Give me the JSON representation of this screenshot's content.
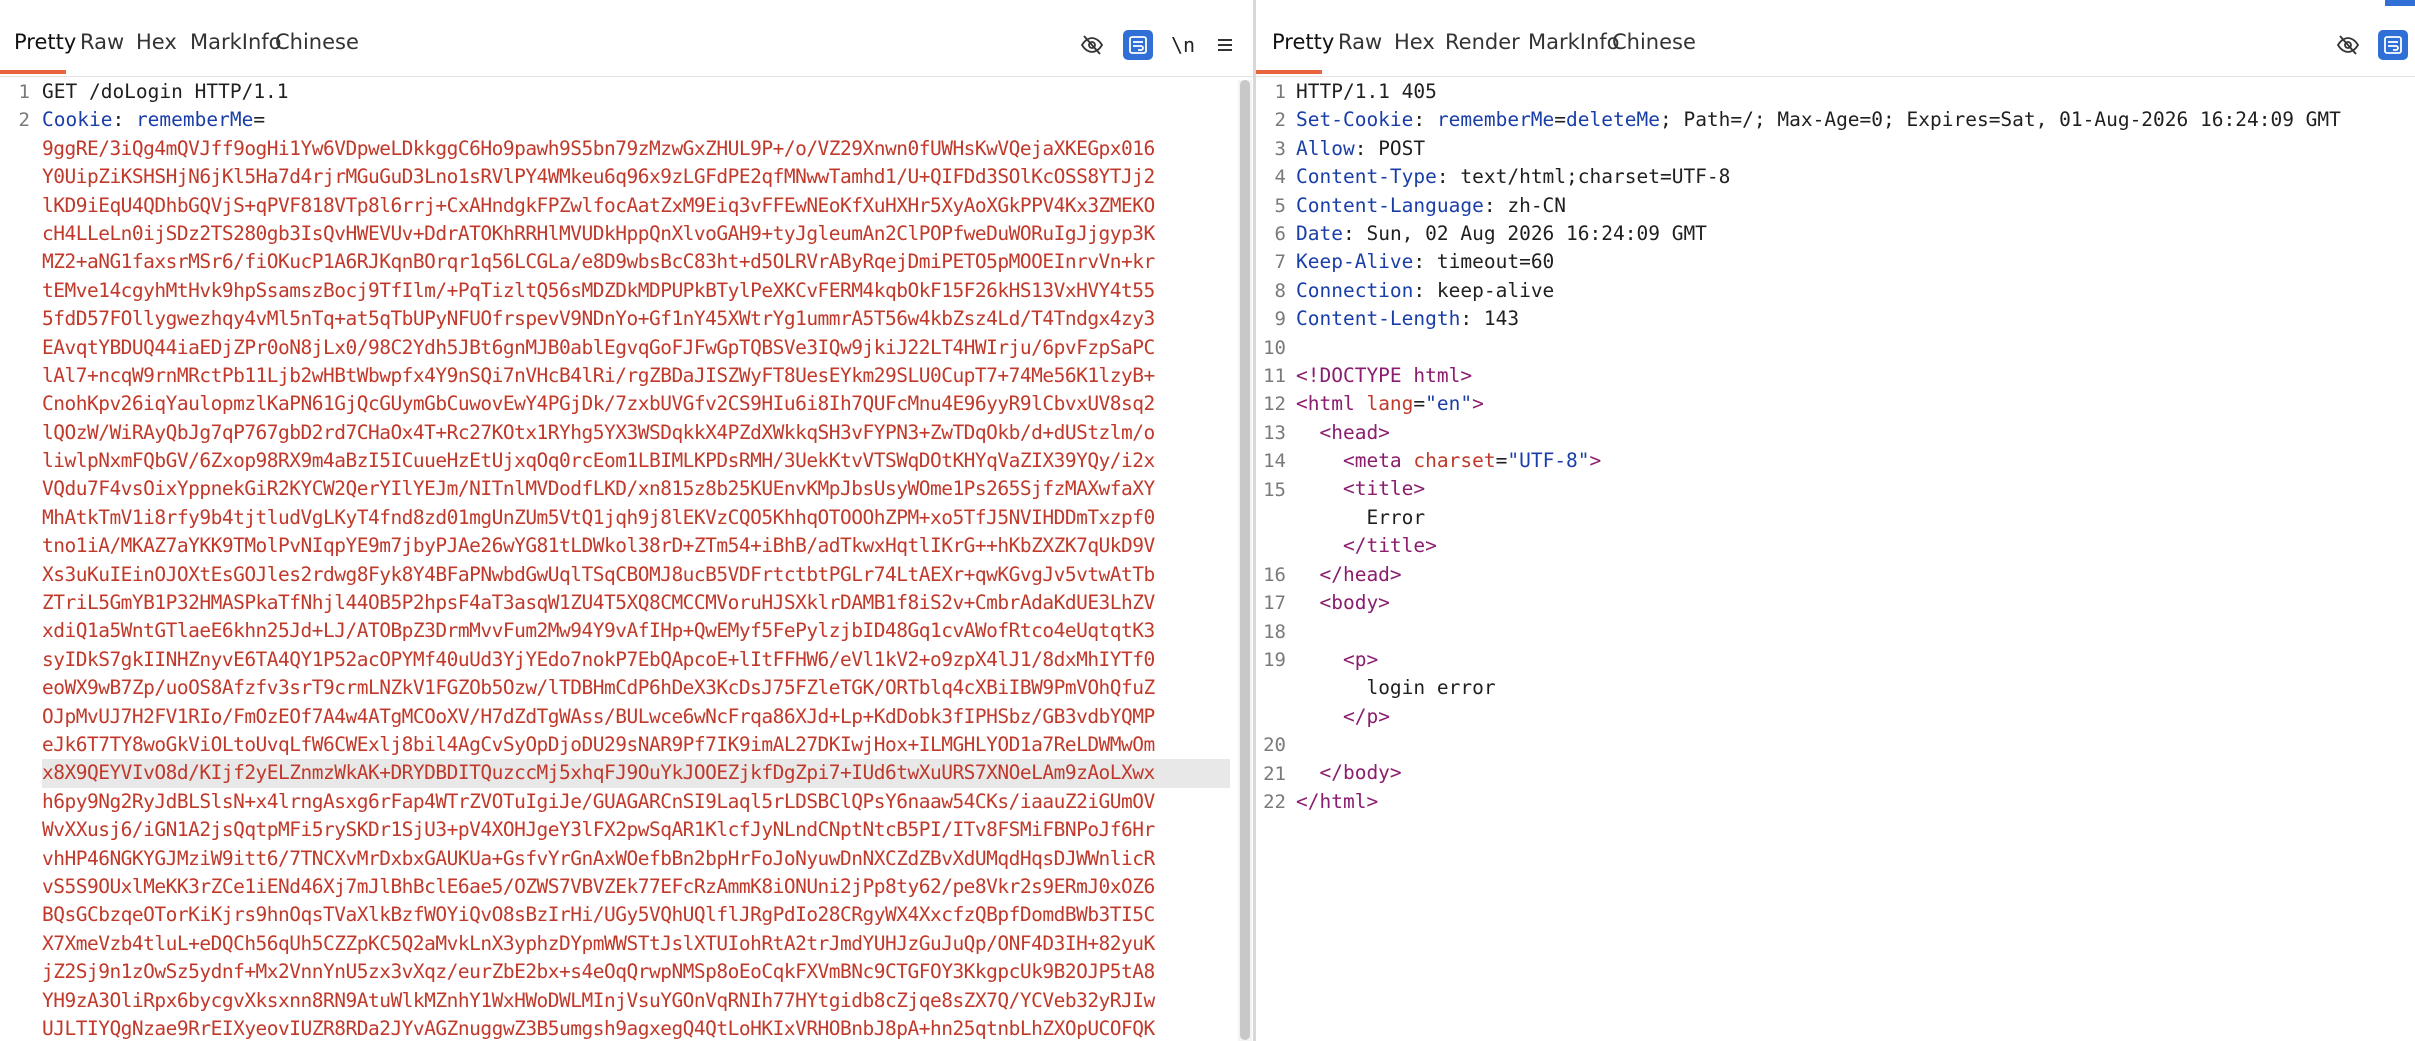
{
  "request": {
    "tabs": [
      "Pretty",
      "Raw",
      "Hex",
      "MarkInfo",
      "Chinese"
    ],
    "active_tab": "Pretty",
    "wrap_label": "\\n",
    "line1": "GET /doLogin HTTP/1.1",
    "cookie_key": "Cookie",
    "cookie_name": "rememberMe",
    "cookie_eq": "=",
    "cookie_lines": [
      "9ggRE/3iQg4mQVJff9ogHi1Yw6VDpweLDkkggC6Ho9pawh9S5bn79zMzwGxZHUL9P+/o/VZ29Xnwn0fUWHsKwVQejaXKEGpx016",
      "Y0UipZiKSHSHjN6jKl5Ha7d4rjrMGuGuD3Lno1sRVlPY4WMkeu6q96x9zLGFdPE2qfMNwwTamhd1/U+QIFDd3SOlKcOSS8YTJj2",
      "lKD9iEqU4QDhbGQVjS+qPVF818VTp8l6rrj+CxAHndgkFPZwlfocAatZxM9Eiq3vFFEwNEoKfXuHXHr5XyAoXGkPPV4Kx3ZMEKO",
      "cH4LLeLn0ijSDz2TS280gb3IsQvHWEVUv+DdrATOKhRRHlMVUDkHppQnXlvoGAH9+tyJgleumAn2ClPOPfweDuWORuIgJjgyp3K",
      "MZ2+aNG1faxsrMSr6/fiOKucP1A6RJKqnBOrqr1q56LCGLa/e8D9wbsBcC83ht+d5OLRVrAByRqejDmiPETO5pMOOEInrvVn+kr",
      "tEMve14cgyhMtHvk9hpSsamszBocj9TfIlm/+PqTizltQ56sMDZDkMDPUPkBTylPeXKCvFERM4kqbOkF15F26kHS13VxHVY4t55",
      "5fdD57FOllygwezhqy4vMl5nTq+at5qTbUPyNFUOfrspevV9NDnYo+Gf1nY45XWtrYg1ummrA5T56w4kbZsz4Ld/T4Tndgx4zy3",
      "EAvqtYBDUQ44iaEDjZPr0oN8jLx0/98C2Ydh5JBt6gnMJB0ablEgvqGoFJFwGpTQBSVe3IQw9jkiJ22LT4HWIrju/6pvFzpSaPC",
      "lAl7+ncqW9rnMRctPb11Ljb2wHBtWbwpfx4Y9nSQi7nVHcB4lRi/rgZBDaJISZWyFT8UesEYkm29SLU0CupT7+74Me56K1lzyB+",
      "CnohKpv26iqYaulopmzlKaPN61GjQcGUymGbCuwovEwY4PGjDk/7zxbUVGfv2CS9HIu6i8Ih7QUFcMnu4E96yyR9lCbvxUV8sq2",
      "lQOzW/WiRAyQbJg7qP767gbD2rd7CHaOx4T+Rc27KOtx1RYhg5YX3WSDqkkX4PZdXWkkqSH3vFYPN3+ZwTDqOkb/d+dUStzlm/o",
      "liwlpNxmFQbGV/6Zxop98RX9m4aBzI5ICuueHzEtUjxqOq0rcEom1LBIMLKPDsRMH/3UekKtvVTSWqDOtKHYqVaZIX39YQy/i2x",
      "VQdu7F4vsOixYppnekGiR2KYCW2QerYIlYEJm/NITnlMVDodfLKD/xn815z8b25KUEnvKMpJbsUsyWOme1Ps265SjfzMAXwfaXY",
      "MhAtkTmV1i8rfy9b4tjtludVgLKyT4fnd8zd01mgUnZUm5VtQ1jqh9j8lEKVzCQO5KhhqOTOOOhZPM+xo5TfJ5NVIHDDmTxzpf0",
      "tno1iA/MKAZ7aYKK9TMolPvNIqpYE9m7jbyPJAe26wYG81tLDWkol38rD+ZTm54+iBhB/adTkwxHqtlIKrG++hKbZXZK7qUkD9V",
      "Xs3uKuIEinOJOXtEsGOJles2rdwg8Fyk8Y4BFaPNwbdGwUqlTSqCBOMJ8ucB5VDFrtctbtPGLr74LtAEXr+qwKGvgJv5vtwAtTb",
      "ZTriL5GmYB1P32HMASPkaTfNhjl44OB5P2hpsF4aT3asqW1ZU4T5XQ8CMCCMVoruHJSXklrDAMB1f8iS2v+CmbrAdaKdUE3LhZV",
      "xdiQ1a5WntGTlaeE6khn25Jd+LJ/ATOBpZ3DrmMvvFum2Mw94Y9vAfIHp+QwEMyf5FePylzjbID48Gq1cvAWofRtco4eUqtqtK3",
      "syIDkS7gkIINHZnyvE6TA4QY1P52acOPYMf40uUd3YjYEdo7nokP7EbQApcoE+lItFFHW6/eVl1kV2+o9zpX4lJ1/8dxMhIYTf0",
      "eoWX9wB7Zp/uoOS8Afzfv3srT9crmLNZkV1FGZOb5Ozw/lTDBHmCdP6hDeX3KcDsJ75FZleTGK/ORTblq4cXBiIBW9PmVOhQfuZ",
      "OJpMvUJ7H2FV1RIo/FmOzEOf7A4w4ATgMCOoXV/H7dZdTgWAss/BULwce6wNcFrqa86XJd+Lp+KdDobk3fIPHSbz/GB3vdbYQMP",
      "eJk6T7TY8woGkViOLtoUvqLfW6CWExlj8bil4AgCvSyOpDjoDU29sNAR9Pf7IK9imAL27DKIwjHox+ILMGHLYOD1a7ReLDWMwOm",
      "x8X9QEYVIvO8d/KIjf2yELZnmzWkAK+DRYDBDITQuzccMj5xhqFJ9OuYkJOOEZjkfDgZpi7+IUd6twXuURS7XNOeLAm9zAoLXwx",
      "h6py9Ng2RyJdBLSlsN+x4lrngAsxg6rFap4WTrZVOTuIgiJe/GUAGARCnSI9Laql5rLDSBClQPsY6naaw54CKs/iaauZ2iGUmOV",
      "WvXXusj6/iGN1A2jsQqtpMFi5rySKDr1SjU3+pV4XOHJgeY3lFX2pwSqAR1KlcfJyNLndCNptNtcB5PI/ITv8FSMiFBNPoJf6Hr",
      "vhHP46NGKYGJMziW9itt6/7TNCXvMrDxbxGAUKUa+GsfvYrGnAxWOefbBn2bpHrFoJoNyuwDnNXCZdZBvXdUMqdHqsDJWWnlicR",
      "vS5S9OUxlMeKK3rZCe1iENd46Xj7mJlBhBclE6ae5/OZWS7VBVZEk77EFcRzAmmK8iONUni2jPp8ty62/pe8Vkr2s9ERmJ0xOZ6",
      "BQsGCbzqeOTorKiKjrs9hnOqsTVaXlkBzfWOYiQvO8sBzIrHi/UGy5VQhUQlflJRgPdIo28CRgyWX4XxcfzQBpfDomdBWb3TI5C",
      "X7XmeVzb4tluL+eDQCh56qUh5CZZpKC5Q2aMvkLnX3yphzDYpmWWSTtJslXTUIohRtA2trJmdYUHJzGuJuQp/ONF4D3IH+82yuK",
      "jZ2Sj9n1zOwSz5ydnf+Mx2VnnYnU5zx3vXqz/eurZbE2bx+s4eOqQrwpNMSp8oEoCqkFXVmBNc9CTGFOY3KkgpcUk9B2OJP5tA8",
      "YH9zA3OliRpx6bycgvXksxnn8RN9AtuWlkMZnhY1WxHWoDWLMInjVsuYGOnVqRNIh77HYtgidb8cZjqe8sZX7Q/YCVeb32yRJIw",
      "UJLTIYQgNzae9RrEIXyeovIUZR8RDa2JYvAGZnuggwZ3B5umgsh9agxegQ4QtLoHKIxVRHOBnbJ8pA+hn25qtnbLhZXOpUCOFQK"
    ]
  },
  "response": {
    "tabs": [
      "Pretty",
      "Raw",
      "Hex",
      "Render",
      "MarkInfo",
      "Chinese"
    ],
    "active_tab": "Pretty",
    "status": "HTTP/1.1 405",
    "set_cookie_key": "Set-Cookie",
    "set_cookie_name": "rememberMe",
    "set_cookie_eq": "=",
    "set_cookie_val": "deleteMe",
    "set_cookie_rest": "; Path=/; Max-Age=0; Expires=Sat, 01-Aug-2026 16:24:09 GMT",
    "headers": [
      {
        "k": "Allow",
        "v": " POST"
      },
      {
        "k": "Content-Type",
        "v": " text/html;charset=UTF-8"
      },
      {
        "k": "Content-Language",
        "v": " zh-CN"
      },
      {
        "k": "Date",
        "v": " Sun, 02 Aug 2026 16:24:09 GMT"
      },
      {
        "k": "Keep-Alive",
        "v": " timeout=60"
      },
      {
        "k": "Connection",
        "v": " keep-alive"
      },
      {
        "k": "Content-Length",
        "v": " 143"
      }
    ],
    "html": {
      "doctype": "<!DOCTYPE html>",
      "html_open": "<html",
      "lang_attr": "lang",
      "lang_val": "\"en\"",
      "gt": ">",
      "head_open": "<head>",
      "meta_open": "<meta",
      "charset_attr": "charset",
      "charset_val": "\"UTF-8\"",
      "title_open": "<title>",
      "title_text": "Error",
      "title_close": "</title>",
      "head_close": "</head>",
      "body_open": "<body>",
      "p_open": "<p>",
      "p_text": "login error",
      "p_close": "</p>",
      "body_close": "</body>",
      "html_close": "</html>"
    }
  }
}
